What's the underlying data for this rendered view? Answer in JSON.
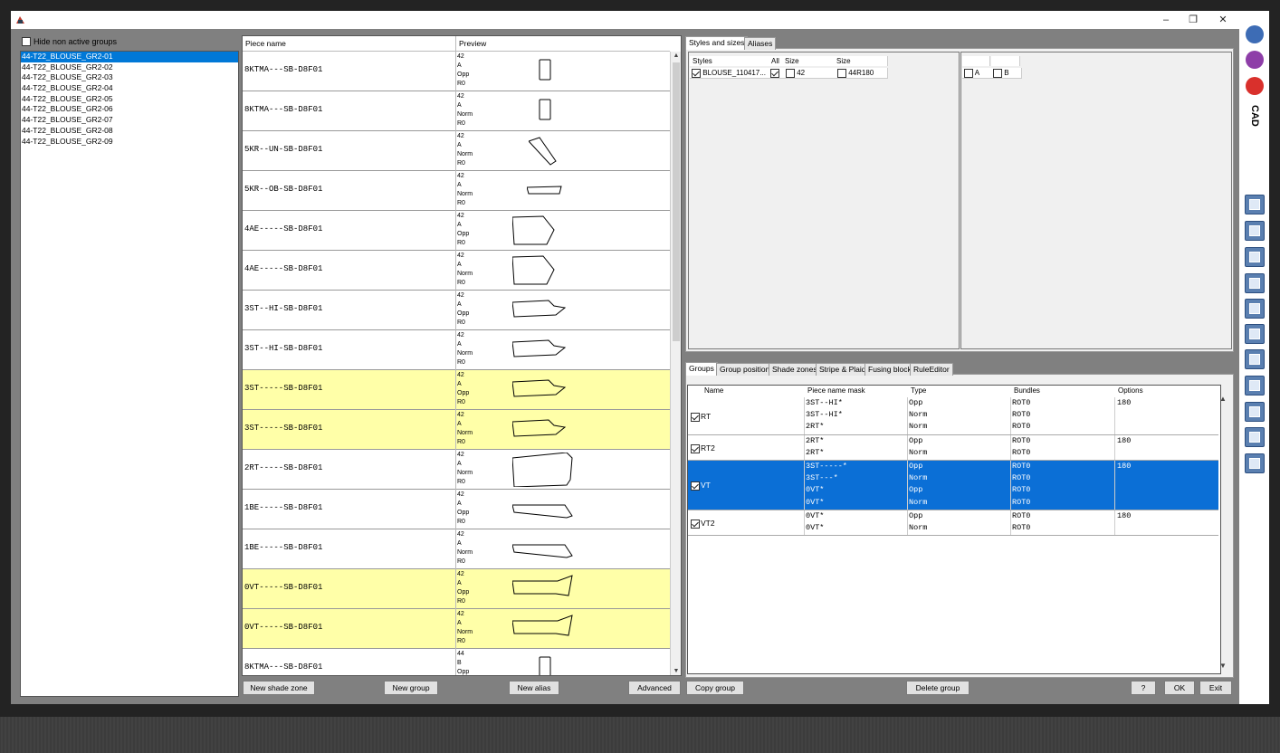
{
  "left": {
    "hide_label": "Hide non active groups",
    "groups": [
      "44-T22_BLOUSE_GR2-01",
      "44-T22_BLOUSE_GR2-02",
      "44-T22_BLOUSE_GR2-03",
      "44-T22_BLOUSE_GR2-04",
      "44-T22_BLOUSE_GR2-05",
      "44-T22_BLOUSE_GR2-06",
      "44-T22_BLOUSE_GR2-07",
      "44-T22_BLOUSE_GR2-08",
      "44-T22_BLOUSE_GR2-09"
    ]
  },
  "pieces": {
    "headers": {
      "name": "Piece name",
      "preview": "Preview"
    },
    "rows": [
      {
        "name": "8KTMA---SB-D8F01",
        "info": [
          "42",
          "A",
          "Opp",
          "R0"
        ],
        "yellow": false,
        "shape": "rect"
      },
      {
        "name": "8KTMA---SB-D8F01",
        "info": [
          "42",
          "A",
          "Norm",
          "R0"
        ],
        "yellow": false,
        "shape": "rect"
      },
      {
        "name": "5KR--UN-SB-D8F01",
        "info": [
          "42",
          "A",
          "Norm",
          "R0"
        ],
        "yellow": false,
        "shape": "strip"
      },
      {
        "name": "5KR--OB-SB-D8F01",
        "info": [
          "42",
          "A",
          "Norm",
          "R0"
        ],
        "yellow": false,
        "shape": "band"
      },
      {
        "name": "4AE-----SB-D8F01",
        "info": [
          "42",
          "A",
          "Opp",
          "R0"
        ],
        "yellow": false,
        "shape": "yoke"
      },
      {
        "name": "4AE-----SB-D8F01",
        "info": [
          "42",
          "A",
          "Norm",
          "R0"
        ],
        "yellow": false,
        "shape": "yoke"
      },
      {
        "name": "3ST--HI-SB-D8F01",
        "info": [
          "42",
          "A",
          "Opp",
          "R0"
        ],
        "yellow": false,
        "shape": "sleeve"
      },
      {
        "name": "3ST--HI-SB-D8F01",
        "info": [
          "42",
          "A",
          "Norm",
          "R0"
        ],
        "yellow": false,
        "shape": "sleeve"
      },
      {
        "name": "3ST-----SB-D8F01",
        "info": [
          "42",
          "A",
          "Opp",
          "R0"
        ],
        "yellow": true,
        "shape": "sleeve"
      },
      {
        "name": "3ST-----SB-D8F01",
        "info": [
          "42",
          "A",
          "Norm",
          "R0"
        ],
        "yellow": true,
        "shape": "sleeve"
      },
      {
        "name": "2RT-----SB-D8F01",
        "info": [
          "42",
          "A",
          "Norm",
          "R0"
        ],
        "yellow": false,
        "shape": "back"
      },
      {
        "name": "1BE-----SB-D8F01",
        "info": [
          "42",
          "A",
          "Opp",
          "R0"
        ],
        "yellow": false,
        "shape": "leg"
      },
      {
        "name": "1BE-----SB-D8F01",
        "info": [
          "42",
          "A",
          "Norm",
          "R0"
        ],
        "yellow": false,
        "shape": "leg"
      },
      {
        "name": "0VT-----SB-D8F01",
        "info": [
          "42",
          "A",
          "Opp",
          "R0"
        ],
        "yellow": true,
        "shape": "front"
      },
      {
        "name": "0VT-----SB-D8F01",
        "info": [
          "42",
          "A",
          "Norm",
          "R0"
        ],
        "yellow": true,
        "shape": "front"
      },
      {
        "name": "8KTMA---SB-D8F01",
        "info": [
          "44",
          "B",
          "Opp"
        ],
        "yellow": false,
        "shape": "rect"
      }
    ]
  },
  "buttons": {
    "new_shade_zone": "New shade zone",
    "new_group": "New group",
    "new_alias": "New alias",
    "advanced": "Advanced",
    "copy_group": "Copy group",
    "delete_group": "Delete group",
    "help": "?",
    "ok": "OK",
    "exit": "Exit"
  },
  "styles_tabs": [
    "Styles and sizes",
    "Aliases"
  ],
  "styles": {
    "headers": [
      "Styles",
      "All",
      "Size",
      "Size"
    ],
    "style_value": "BLOUSE_110417...",
    "size1": "42",
    "size2": "44R180",
    "variants": [
      "A",
      "B"
    ]
  },
  "group_tabs": [
    "Groups",
    "Group position",
    "Shade zones",
    "Stripe & Plaid",
    "Fusing block",
    "RuleEditor"
  ],
  "groups_table": {
    "headers": [
      "Name",
      "Piece name mask",
      "Type",
      "Bundles",
      "Options"
    ],
    "rows": [
      {
        "name": "RT",
        "selected": false,
        "masks": [
          "3ST--HI*",
          "3ST--HI*",
          "2RT*"
        ],
        "types": [
          "Opp",
          "Norm",
          "Norm"
        ],
        "bundles": [
          "ROT0",
          "ROT0",
          "ROT0"
        ],
        "options": "180"
      },
      {
        "name": "RT2",
        "selected": false,
        "masks": [
          "2RT*",
          "2RT*"
        ],
        "types": [
          "Opp",
          "Norm"
        ],
        "bundles": [
          "ROT0",
          "ROT0"
        ],
        "options": "180"
      },
      {
        "name": "VT",
        "selected": true,
        "masks": [
          "3ST-----*",
          "3ST---*",
          "0VT*",
          "0VT*"
        ],
        "types": [
          "Opp",
          "Norm",
          "Opp",
          "Norm"
        ],
        "bundles": [
          "ROT0",
          "ROT0",
          "ROT0",
          "ROT0"
        ],
        "options": "180"
      },
      {
        "name": "VT2",
        "selected": false,
        "masks": [
          "0VT*",
          "0VT*"
        ],
        "types": [
          "Opp",
          "Norm"
        ],
        "bundles": [
          "ROT0",
          "ROT0"
        ],
        "options": "180"
      }
    ]
  },
  "sidebar": {
    "cad_label": "CAD"
  },
  "colors": {
    "selection": "#0078d7",
    "highlight_row": "#ffffa8",
    "window_bg": "#808080"
  }
}
